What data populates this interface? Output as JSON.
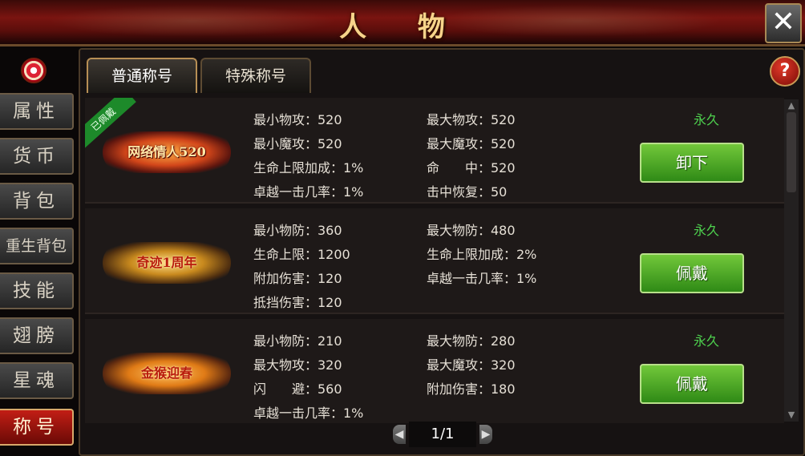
{
  "window": {
    "title": "人 物",
    "close_icon": "close-icon"
  },
  "sidebar": {
    "items": [
      {
        "label": "属性"
      },
      {
        "label": "货币"
      },
      {
        "label": "背包"
      },
      {
        "label": "重生背包"
      },
      {
        "label": "技能"
      },
      {
        "label": "翅膀"
      },
      {
        "label": "星魂"
      },
      {
        "label": "称号"
      }
    ],
    "active_index": 7
  },
  "tabs": [
    {
      "label": "普通称号"
    },
    {
      "label": "特殊称号"
    }
  ],
  "help": {
    "label": "?"
  },
  "titles": [
    {
      "badge_text": "网络情人520",
      "equipped_label": "已佩戴",
      "stats": [
        "最小物攻：520",
        "最大物攻：520",
        "最小魔攻：520",
        "最大魔攻：520",
        "生命上限加成：1%",
        "命　　中：520",
        "卓越一击几率：1%",
        "击中恢复：50"
      ],
      "duration": "永久",
      "action": "卸下"
    },
    {
      "badge_text": "奇迹1周年",
      "stats": [
        "最小物防：360",
        "最大物防：480",
        "生命上限：1200",
        "生命上限加成：2%",
        "附加伤害：120",
        "卓越一击几率：1%",
        "抵挡伤害：120",
        ""
      ],
      "duration": "永久",
      "action": "佩戴"
    },
    {
      "badge_text": "金猴迎春",
      "stats": [
        "最小物防：210",
        "最大物防：280",
        "最大物攻：320",
        "最大魔攻：320",
        "闪　　避：560",
        "附加伤害：180",
        "卓越一击几率：1%",
        ""
      ],
      "duration": "永久",
      "action": "佩戴"
    }
  ],
  "pager": {
    "text": "1/1"
  },
  "colors": {
    "accent_green": "#4ed14e",
    "button_green": "#2f8a16",
    "active_red": "#c21e15"
  }
}
